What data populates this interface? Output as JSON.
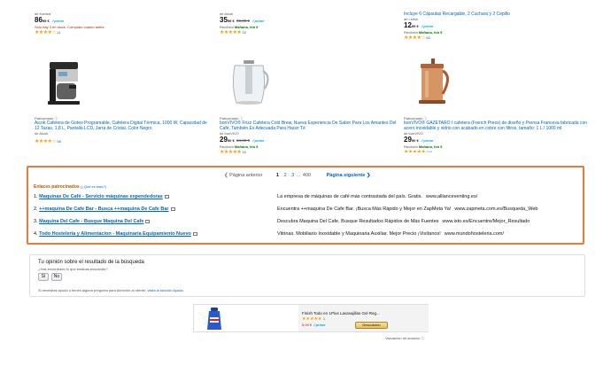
{
  "top_row": {
    "col1": {
      "seller": "de Kamira",
      "price_int": "86",
      "price_dec": "95 €",
      "prime": "✓prime",
      "stock": "Sólo hay 3 en stock. Cómpralo cuanto antes.",
      "stars": "★★★★☆",
      "reviews": "11"
    },
    "col2": {
      "seller": "de Aicok",
      "price_int": "35",
      "price_dec": "99 €",
      "old_price": "59,99 €",
      "prime": "✓prime",
      "delivery_prefix": "Recíbelo",
      "delivery_day": "Mañana, feb 5",
      "stars": "★★★★★",
      "reviews": "33"
    },
    "col3": {
      "title": "Incluye 6 Cápsulas Recargable, 2 Cuchara y 2 Cepillo",
      "seller": "de Linkin",
      "price_int": "12",
      "price_dec": "99 €",
      "prime": "✓prime",
      "delivery_prefix": "Recíbelo",
      "delivery_day": "Mañana, feb 5",
      "stars": "★★★★☆",
      "reviews": "60"
    }
  },
  "products": [
    {
      "sponsored": "Patrocinado ⓘ",
      "title": "Aicok Cafetera de Goteo Programable, Cafetera Digital Térmica, 1000 W, Capacidad de 12 Tazas, 1,8 L, Pantalla LCD, Jarra de Cristal, Color Negro",
      "seller": "de Aicok",
      "stars": "★★★★☆",
      "reviews": "58"
    },
    {
      "sponsored": "Patrocinado ⓘ",
      "title": "bonVIVO® Frizz Cafetera Cold Brew, Nueva Experiencia De Sabor Para Los Amantes Del Café, También Es Adecuada Para Hacer Té",
      "seller": "de bonVIVO",
      "price_int": "29",
      "price_dec": "90 €",
      "old_price": "34,90 €",
      "prime": "✓prime",
      "delivery_prefix": "Recíbelo",
      "delivery_day": "Mañana, feb 5",
      "stars": "★★★★★",
      "reviews": "33"
    },
    {
      "sponsored": "Patrocinado ⓘ",
      "title": "bonVIVO® GAZETARO I cafetera (French Press) de diseño y Prensa Francesa fabricada con acero inoxidable y vidrio con acabado en cobre con filtros, tamaño: 1 L / 1000 ml",
      "seller": "de bonVIVO",
      "price_int": "29",
      "price_dec": "90 €",
      "prime": "✓prime",
      "delivery_prefix": "Recíbelo",
      "delivery_day": "Mañana, feb 5",
      "stars": "★★★★★",
      "reviews": "119"
    }
  ],
  "pager": {
    "prev": "Página anterior",
    "pages": [
      "1",
      "2",
      "3",
      "...",
      "400"
    ],
    "next": "Página siguiente"
  },
  "sponsored_links": {
    "heading": "Enlaces patrocinados",
    "what": "(¿Qué es esto?)",
    "items": [
      {
        "num": "1.",
        "title": "Maquinas De Café - Servicio máquinas expendedoras",
        "desc": "La empresa de máquinas de café más contrastada del país. Gratis.",
        "url": "www.allianceventing.es/"
      },
      {
        "num": "2.",
        "title": "++maquina De Cafe Bar - Busca ++maquina De Cafe Bar",
        "desc": "Encuentra ++maquina De Cafe Bar. ¡Busca Más Rápido y Mejor en ZapMeta Ya!",
        "url": "www.zapmeta.com.es/Busqueda_Web"
      },
      {
        "num": "3.",
        "title": "Maquina Del Cafe - Busque Maquina Del Cafe",
        "desc": "Descubra Maquina Del Cafe. Busque Resultados Rápidos de Más Fuentes",
        "url": "www.ixto.es/Encuentre/Mejor_Resultado"
      },
      {
        "num": "4.",
        "title": "Todo Hosteleria y Alimentacion - Maquinaria Equipamiento Nuevo",
        "desc": "Vitrinas. Mobiliario Inoxidable y Maquinaria Auxiliar. Mejor Precio ¡Visítanos!",
        "url": "www.mundohosteleria.com/"
      }
    ]
  },
  "feedback": {
    "question": "Tu opinión sobre el resultado de la búsqueda",
    "sub": "¿Has encontrado lo que estabas buscando?",
    "yes": "Sí",
    "no": "No",
    "help_prefix": "Si necesitas ayuda o tienes alguna pregunta para Atención al cliente,",
    "help_link": "visita la sección Ayuda."
  },
  "banner": {
    "title": "Finish Todo en 1Plus Lavavajillas Gel Reg...",
    "stars": "★★★★★",
    "reviews": "1",
    "price": "5,09 €",
    "prime": "✓prime",
    "button": "Descúbrelo"
  },
  "ad_feedback": "Valoración de anuncio ⓘ",
  "colors": {
    "accent_orange": "#ee7a3a",
    "link": "#0066c0",
    "price_red": "#b12704",
    "star": "#f0a30a",
    "prime": "#00a8e1"
  }
}
